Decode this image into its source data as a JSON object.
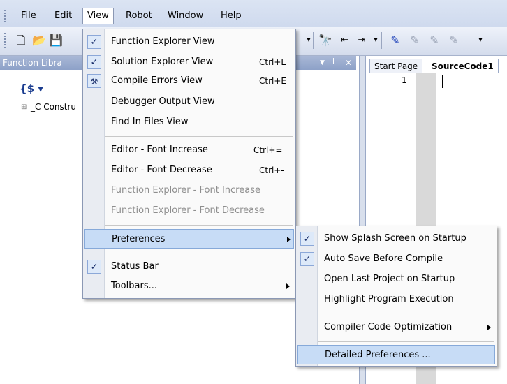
{
  "menubar": {
    "items": [
      "File",
      "Edit",
      "View",
      "Robot",
      "Window",
      "Help"
    ]
  },
  "left_panel": {
    "title": "Function Libra",
    "tree_item": "_C Constru",
    "tree_expander": "⊞"
  },
  "editor": {
    "tabs": [
      "Start Page",
      "SourceCode1"
    ],
    "line_number": "1"
  },
  "view_menu": {
    "items": [
      {
        "label": "Function Explorer View",
        "shortcut": "",
        "checked": true
      },
      {
        "label": "Solution Explorer View",
        "shortcut": "Ctrl+L",
        "checked": true
      },
      {
        "label": "Compile Errors View",
        "shortcut": "Ctrl+E",
        "checked": false,
        "icon": "compile-errors-icon"
      },
      {
        "label": "Debugger Output View",
        "shortcut": ""
      },
      {
        "label": "Find In Files View",
        "shortcut": ""
      },
      {
        "label": "Editor - Font Increase",
        "shortcut": "Ctrl+="
      },
      {
        "label": "Editor - Font Decrease",
        "shortcut": "Ctrl+-"
      },
      {
        "label": "Function Explorer - Font Increase",
        "shortcut": "",
        "disabled": true
      },
      {
        "label": "Function Explorer - Font Decrease",
        "shortcut": "",
        "disabled": true
      },
      {
        "label": "Preferences",
        "submenu": true,
        "highlighted": true
      },
      {
        "label": "Status Bar",
        "checked": true
      },
      {
        "label": "Toolbars...",
        "submenu": true
      }
    ]
  },
  "preferences_menu": {
    "items": [
      {
        "label": "Show Splash Screen on Startup",
        "checked": true
      },
      {
        "label": "Auto Save Before Compile",
        "checked": true
      },
      {
        "label": "Open Last Project on Startup",
        "checked": false
      },
      {
        "label": "Highlight Program Execution",
        "checked": false
      },
      {
        "label": "Compiler Code Optimization",
        "submenu": true
      },
      {
        "label": "Detailed Preferences ...",
        "highlighted": true
      }
    ]
  },
  "colors": {
    "menu_highlight": "#c7dcf6",
    "toolbar": "#d4dcec",
    "panel_header": "#8da1c8"
  }
}
